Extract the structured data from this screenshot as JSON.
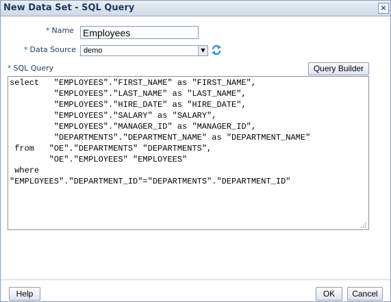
{
  "window": {
    "title": "New Data Set - SQL Query",
    "close_label": "×"
  },
  "form": {
    "name_label": "Name",
    "name_value": "Employees",
    "data_source_label": "Data Source",
    "data_source_value": "demo",
    "required_marker": "*",
    "sql_query_label": "SQL Query",
    "query_builder_label": "Query Builder",
    "sql_text": "select   \"EMPLOYEES\".\"FIRST_NAME\" as \"FIRST_NAME\",\n         \"EMPLOYEES\".\"LAST_NAME\" as \"LAST_NAME\",\n         \"EMPLOYEES\".\"HIRE_DATE\" as \"HIRE_DATE\",\n         \"EMPLOYEES\".\"SALARY\" as \"SALARY\",\n         \"EMPLOYEES\".\"MANAGER_ID\" as \"MANAGER_ID\",\n         \"DEPARTMENTS\".\"DEPARTMENT_NAME\" as \"DEPARTMENT_NAME\"\n from   \"OE\".\"DEPARTMENTS\" \"DEPARTMENTS\",\n        \"OE\".\"EMPLOYEES\" \"EMPLOYEES\"\n where\n\"EMPLOYEES\".\"DEPARTMENT_ID\"=\"DEPARTMENTS\".\"DEPARTMENT_ID\""
  },
  "footer": {
    "help_label": "Help",
    "ok_label": "OK",
    "cancel_label": "Cancel"
  }
}
